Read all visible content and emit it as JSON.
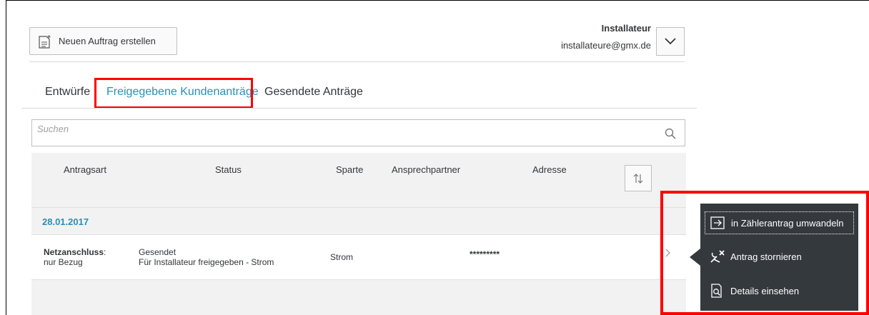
{
  "toolbar": {
    "new_order_label": "Neuen Auftrag erstellen"
  },
  "user": {
    "role": "Installateur",
    "email": "installateure@gmx.de"
  },
  "tabs": [
    {
      "label": "Entwürfe",
      "selected": false
    },
    {
      "label": "Freigegebene Kundenanträge",
      "selected": true
    },
    {
      "label": "Gesendete Anträge",
      "selected": false
    }
  ],
  "search": {
    "placeholder": "Suchen"
  },
  "table": {
    "columns": [
      "Antragsart",
      "Status",
      "Sparte",
      "Ansprechpartner",
      "Adresse"
    ],
    "group_date": "28.01.2017",
    "rows": [
      {
        "type_bold": "Netzanschluss",
        "type_suffix": ":",
        "type_sub": "nur Bezug",
        "status": "Gesendet",
        "status_sub": "Für Installateur freigegeben - Strom",
        "sparte": "Strom",
        "contact": "*********",
        "address": ""
      }
    ]
  },
  "context_menu": {
    "items": [
      {
        "label": "in Zählerantrag umwandeln",
        "icon": "convert-icon"
      },
      {
        "label": "Antrag stornieren",
        "icon": "cancel-tools-icon"
      },
      {
        "label": "Details einsehen",
        "icon": "details-search-icon"
      }
    ]
  },
  "colors": {
    "accent": "#2a8fb5",
    "highlight": "#ff0000",
    "menu_bg": "#34393d"
  }
}
